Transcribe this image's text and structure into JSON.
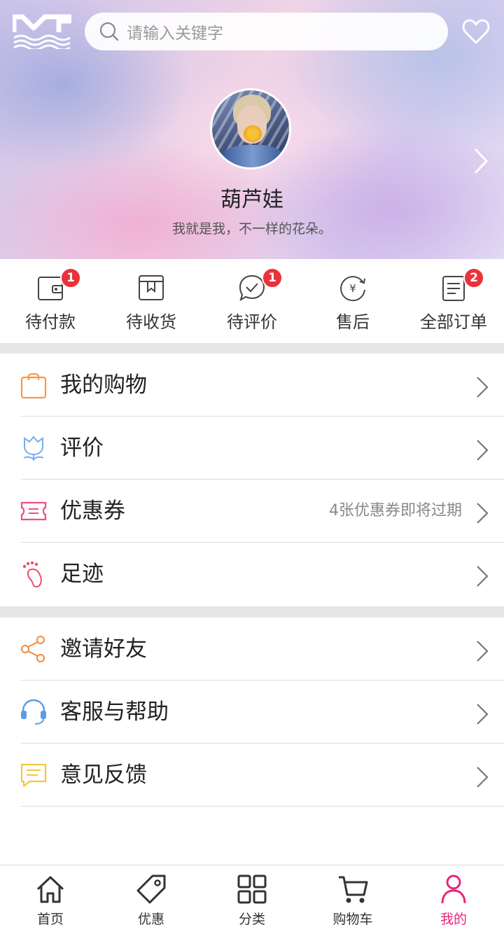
{
  "header": {
    "search_placeholder": "请输入关键字",
    "username": "葫芦娃",
    "bio": "我就是我，不一样的花朵。"
  },
  "orders": [
    {
      "label": "待付款",
      "icon": "wallet-icon",
      "badge": "1"
    },
    {
      "label": "待收货",
      "icon": "package-icon",
      "badge": ""
    },
    {
      "label": "待评价",
      "icon": "comment-check-icon",
      "badge": "1"
    },
    {
      "label": "售后",
      "icon": "yen-refresh-icon",
      "badge": ""
    },
    {
      "label": "全部订单",
      "icon": "order-list-icon",
      "badge": "2"
    }
  ],
  "menu1": [
    {
      "label": "我的购物",
      "hint": "",
      "icon": "shopping-bag-icon",
      "color": "#f29b4b"
    },
    {
      "label": "评价",
      "hint": "",
      "icon": "tulip-icon",
      "color": "#7aaee8"
    },
    {
      "label": "优惠券",
      "hint": "4张优惠券即将过期",
      "icon": "ticket-icon",
      "color": "#ef4d8c"
    },
    {
      "label": "足迹",
      "hint": "",
      "icon": "footprint-icon",
      "color": "#ee4d6e"
    }
  ],
  "menu2": [
    {
      "label": "邀请好友",
      "hint": "",
      "icon": "share-icon",
      "color": "#f08a3c"
    },
    {
      "label": "客服与帮助",
      "hint": "",
      "icon": "headset-icon",
      "color": "#5b9be8"
    },
    {
      "label": "意见反馈",
      "hint": "",
      "icon": "feedback-icon",
      "color": "#f5c63d"
    }
  ],
  "tabs": [
    {
      "label": "首页",
      "icon": "home-icon",
      "active": false
    },
    {
      "label": "优惠",
      "icon": "tag-icon",
      "active": false
    },
    {
      "label": "分类",
      "icon": "category-grid-icon",
      "active": false
    },
    {
      "label": "购物车",
      "icon": "cart-icon",
      "active": false
    },
    {
      "label": "我的",
      "icon": "person-icon",
      "active": true
    }
  ],
  "colors": {
    "accent": "#e8267b",
    "badge": "#e9323b"
  }
}
